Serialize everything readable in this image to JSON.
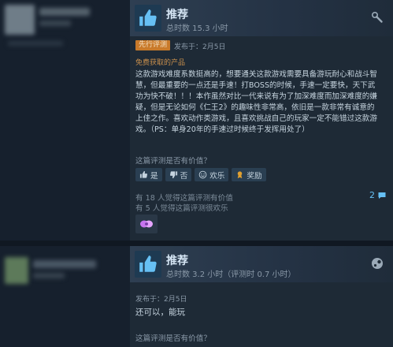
{
  "review1": {
    "recommendation": "推荐",
    "hours": "总时数 15.3 小时",
    "early_access_badge": "先行评测",
    "posted": "发布于：2月5日",
    "free_product": "免费获取的产品",
    "body": "这款游戏难度系数挺高的，想要通关这款游戏需要具备游玩耐心和战斗智慧，但最重要的一点还是手速！打BOSS的时候，手速一定要快，天下武功为快不破！！！本作虽然对比一代来说有为了加深难度而加深难度的嫌疑，但是无论如何《仁王2》的趣味性非常高，依旧是一款非常有诚意的上佳之作。喜欢动作类游戏，且喜欢挑战自己的玩家一定不能错过这款游戏。（PS：单身20年的手速过时候终于发挥用处了）",
    "helpful_question": "这篇评测是否有价值？",
    "buttons": {
      "yes": "是",
      "no": "否",
      "funny": "欢乐",
      "award": "奖励"
    },
    "helpful_count": "有 18 人觉得这篇评测有价值",
    "funny_count": "有 5 人觉得这篇评测很欢乐",
    "comment_count": "2"
  },
  "review2": {
    "recommendation": "推荐",
    "hours": "总时数 3.2 小时（评测时 0.7 小时）",
    "posted": "发布于：2月5日",
    "body": "还可以，能玩",
    "helpful_question": "这篇评测是否有价值？"
  },
  "colors": {
    "background": "#1b2838",
    "link": "#66c0f4",
    "early_access": "#c97a2a",
    "award_purple": "#c774f0"
  },
  "icons": {
    "recommend": "thumbs-up-icon",
    "corner1": "steam-wrench-icon",
    "corner2": "steam-logo-icon",
    "comment": "comment-bubble-icon"
  }
}
